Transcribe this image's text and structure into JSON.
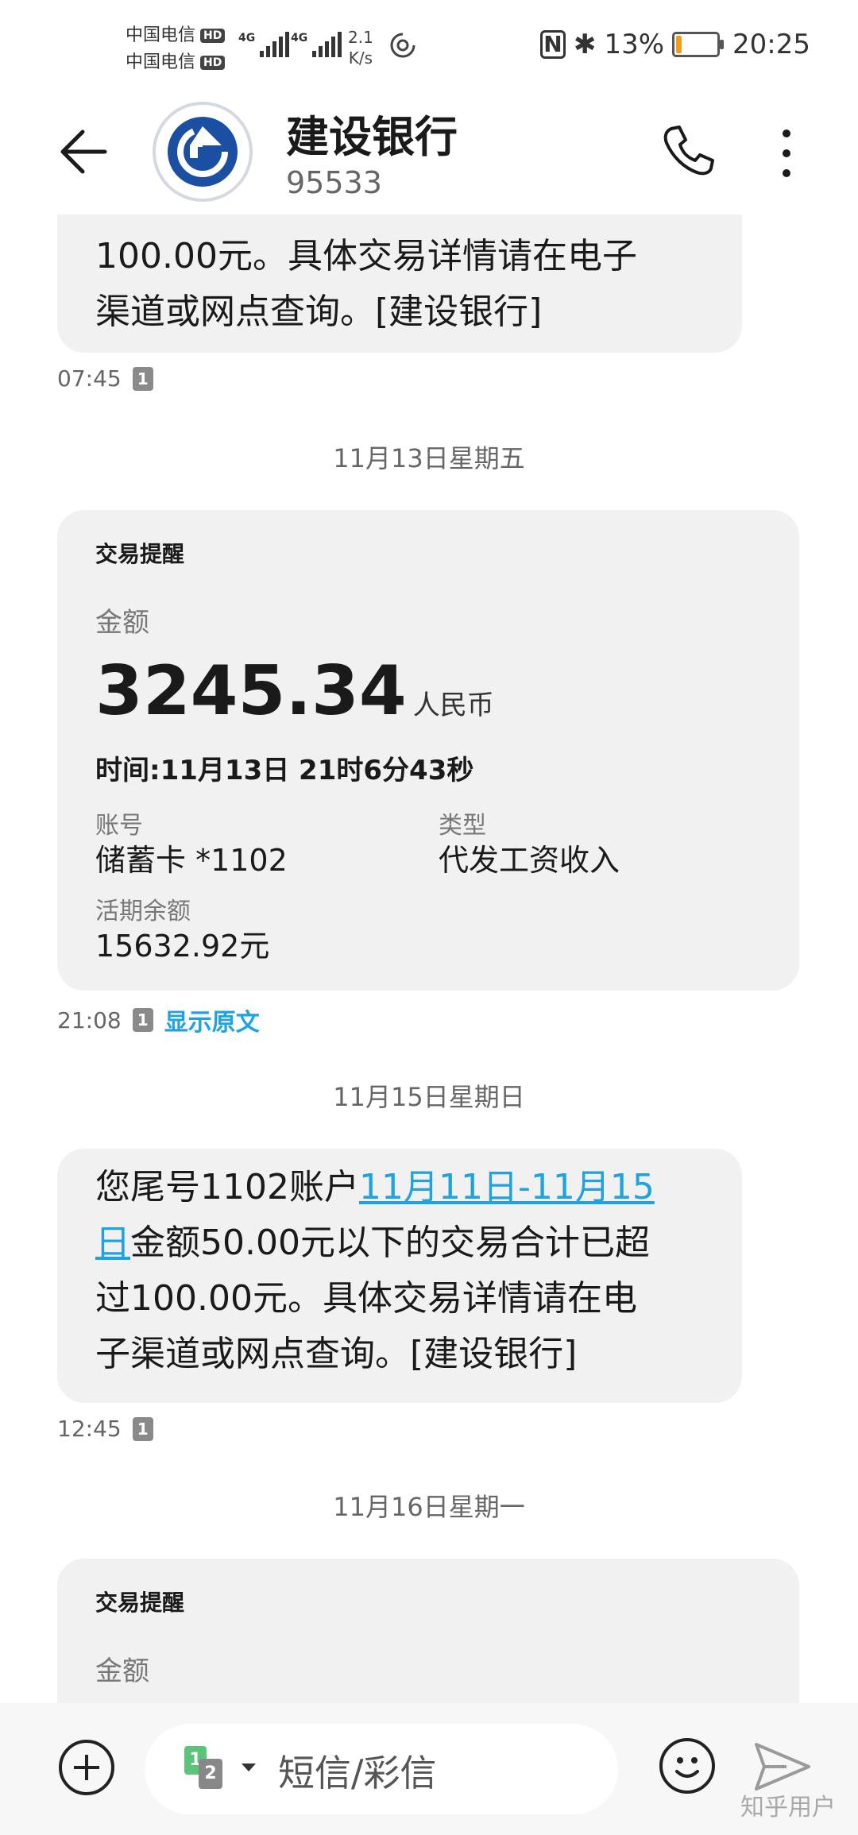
{
  "status_bar": {
    "carrier1": "中国电信",
    "carrier2": "中国电信",
    "hd": "HD",
    "net": "4G",
    "speed_value": "2.1",
    "speed_unit": "K/s",
    "battery_percent": "13%",
    "battery_level": 0.13,
    "time": "20:25"
  },
  "header": {
    "contact_name": "建设银行",
    "contact_number": "95533"
  },
  "messages": {
    "top_partial": {
      "line1": "100.00元。具体交易详情请在电子",
      "line2": "渠道或网点查询。[建设银行]",
      "time": "07:45",
      "sim": "1"
    },
    "date1": "11月13日星期五",
    "card1": {
      "label": "交易提醒",
      "amount_label": "金额",
      "amount": "3245.34",
      "currency": "人民币",
      "time_line": "时间:11月13日 21时6分43秒",
      "account_label": "账号",
      "account_value": "储蓄卡 *1102",
      "type_label": "类型",
      "type_value": "代发工资收入",
      "balance_label": "活期余额",
      "balance_value": "15632.92元",
      "time": "21:08",
      "sim": "1",
      "show_original": "显示原文"
    },
    "date2": "11月15日星期日",
    "sms2": {
      "part1": "您尾号1102账户",
      "link1": "11月11日-11月15",
      "link2": "日",
      "part2": "金额50.00元以下的交易合计已超",
      "line3": "过100.00元。具体交易详情请在电",
      "line4": "子渠道或网点查询。[建设银行]",
      "time": "12:45",
      "sim": "1"
    },
    "date3": "11月16日星期一",
    "card2": {
      "label": "交易提醒",
      "amount_label": "金额"
    }
  },
  "input_bar": {
    "sim1": "1",
    "sim2": "2",
    "placeholder": "短信/彩信"
  },
  "watermark": "知乎用户"
}
